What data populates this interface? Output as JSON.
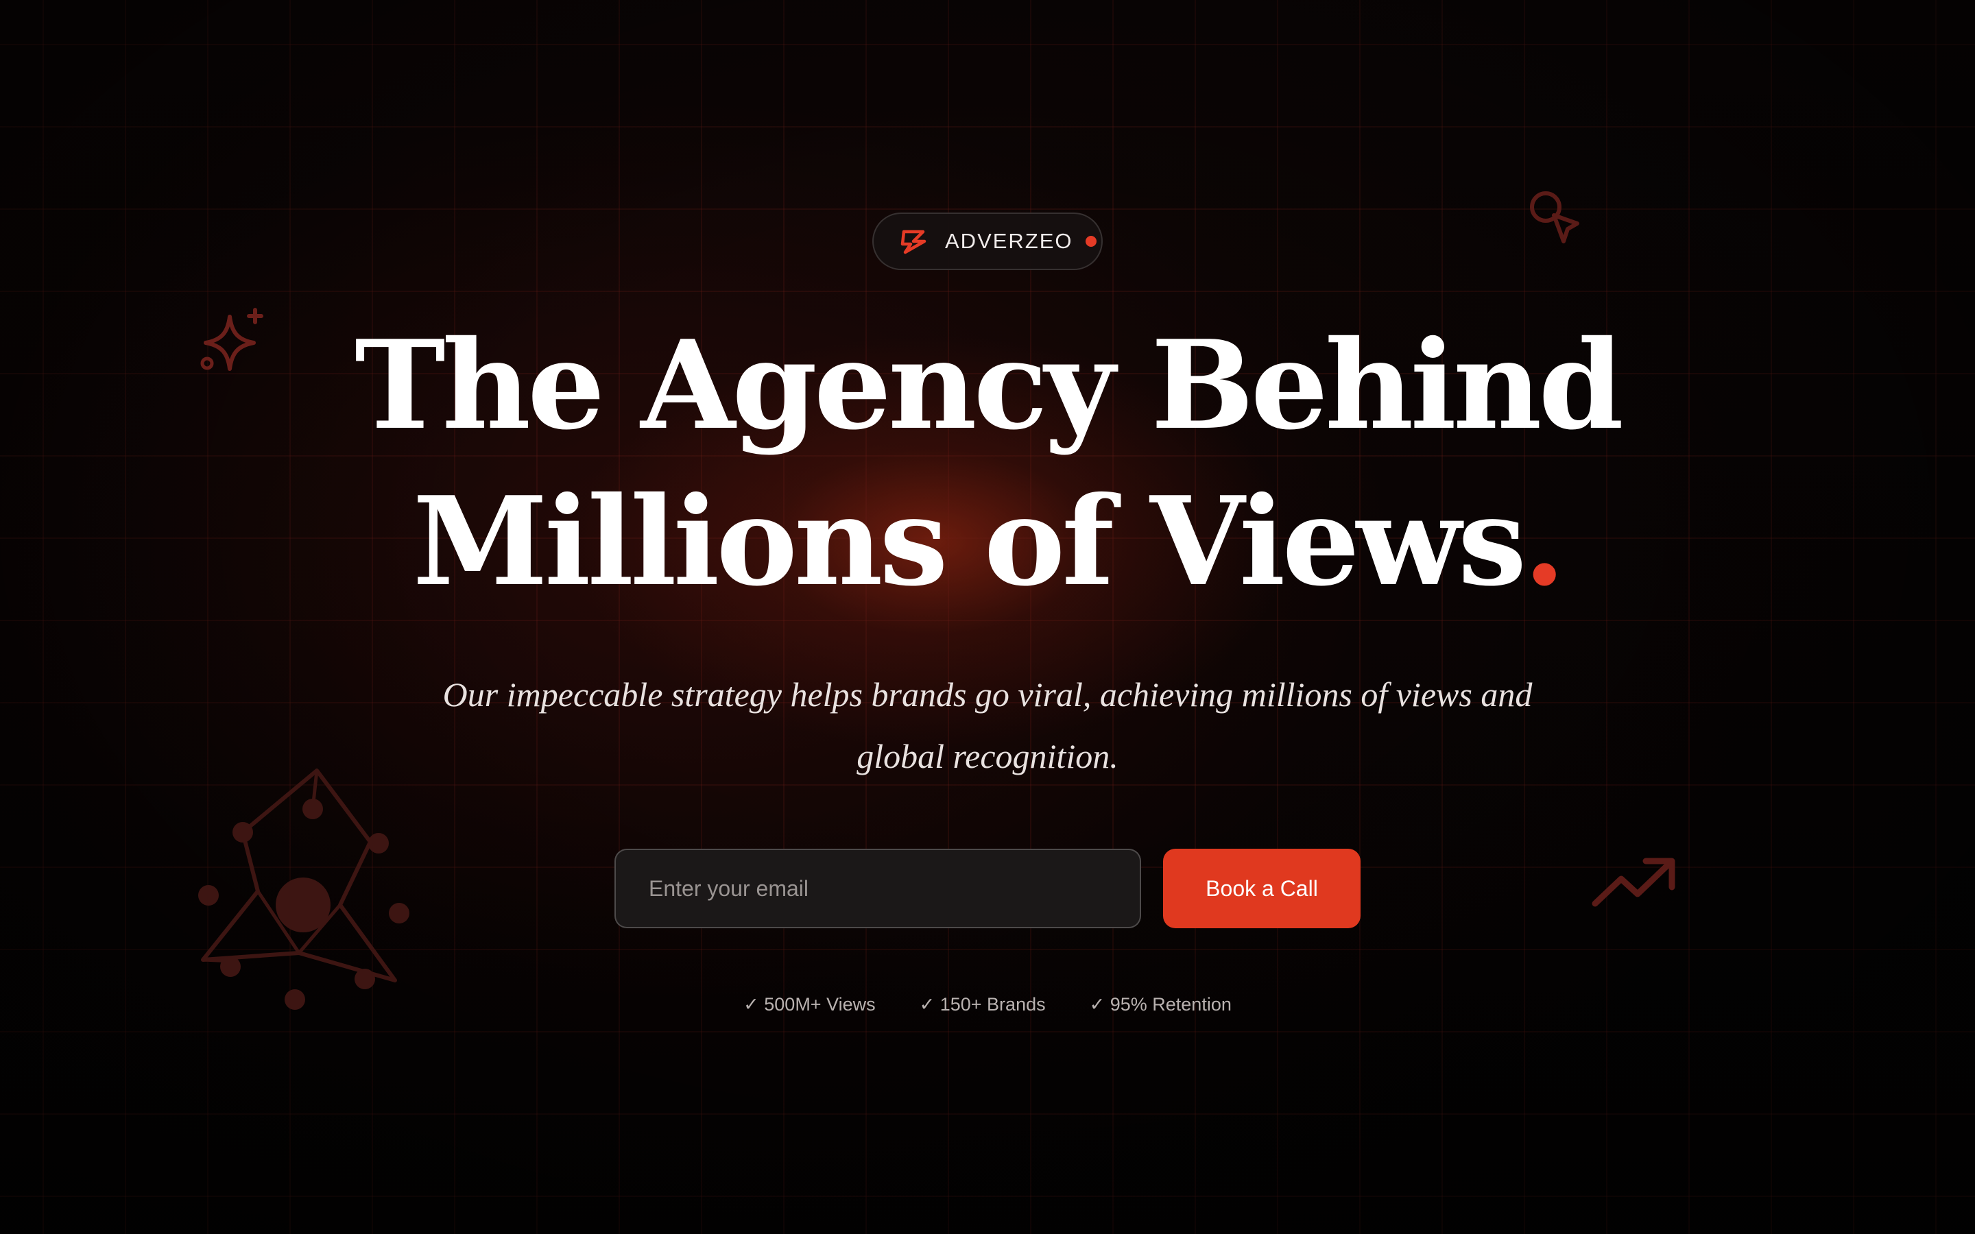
{
  "badge": {
    "logo_icon": "lightning-bolt-icon",
    "label": "ADVERZEO",
    "dot_color": "#e53b26"
  },
  "hero": {
    "headline_line1": "The Agency Behind",
    "headline_line2": "Millions of Views",
    "headline_dot": ".",
    "subtitle": "Our impeccable strategy helps brands go viral, achieving millions of views and global recognition."
  },
  "signup": {
    "email_placeholder": "Enter your email",
    "email_value": "",
    "cta_label": "Book a Call"
  },
  "stats": [
    "✓ 500M+ Views",
    "✓ 150+ Brands",
    "✓ 95% Retention"
  ],
  "decorations": [
    "sparkle-icon",
    "pointer-cursor-icon",
    "network-graph-icon",
    "trending-up-icon"
  ],
  "colors": {
    "accent": "#e53b26",
    "background": "#050303",
    "text": "#ffffff"
  }
}
